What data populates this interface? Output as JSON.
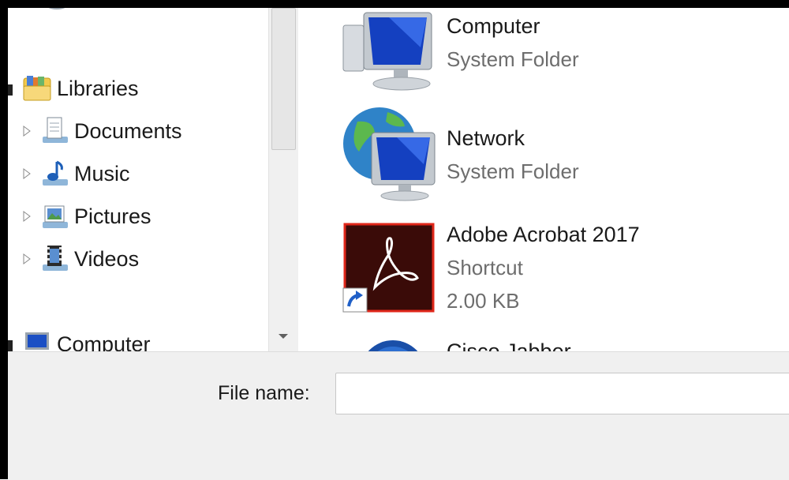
{
  "nav": {
    "items": [
      {
        "label": "Libraries",
        "icon": "libraries-icon"
      },
      {
        "label": "Documents",
        "icon": "documents-icon"
      },
      {
        "label": "Music",
        "icon": "music-icon"
      },
      {
        "label": "Pictures",
        "icon": "pictures-icon"
      },
      {
        "label": "Videos",
        "icon": "videos-icon"
      },
      {
        "label": "Computer",
        "icon": "computer-icon"
      }
    ]
  },
  "content": {
    "files": [
      {
        "name": "Computer",
        "type": "System Folder",
        "icon": "computer-icon"
      },
      {
        "name": "Network",
        "type": "System Folder",
        "icon": "network-icon"
      },
      {
        "name": "Adobe Acrobat 2017",
        "type": "Shortcut",
        "size": "2.00 KB",
        "icon": "adobe-acrobat-icon"
      },
      {
        "name": "Cisco Jabber",
        "icon": "cisco-jabber-icon"
      }
    ]
  },
  "footer": {
    "file_name_label": "File name:",
    "file_name_value": ""
  },
  "colors": {
    "panel_bg": "#f0f0f0",
    "meta_text": "#6d6d6d",
    "acrobat_red": "#e0271a"
  }
}
